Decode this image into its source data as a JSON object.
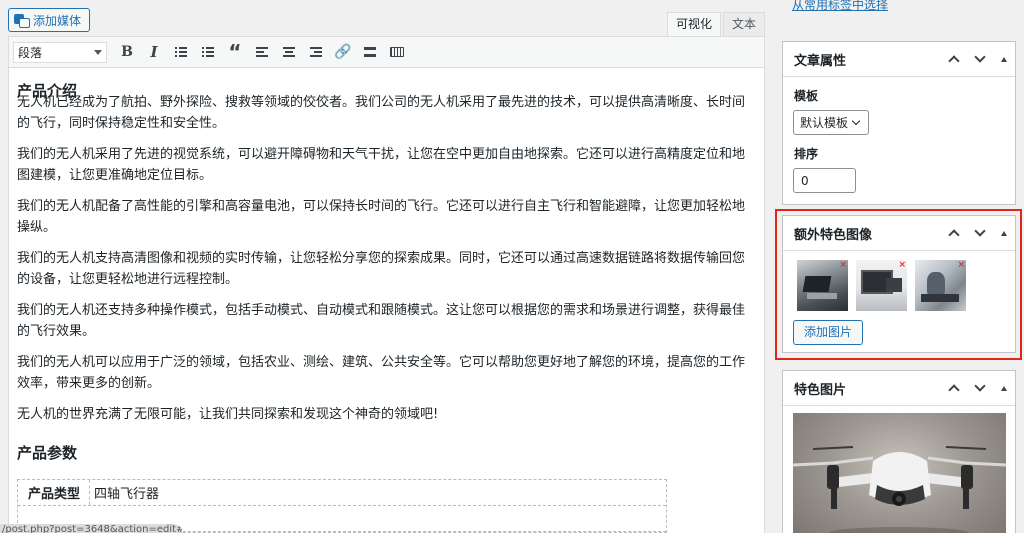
{
  "editor": {
    "add_media_label": "添加媒体",
    "tabs": [
      {
        "label": "可视化",
        "active": true
      },
      {
        "label": "文本",
        "active": false
      }
    ],
    "format_select": "段落",
    "toolbar_icons": [
      "bold-icon",
      "italic-icon",
      "bullet-list-icon",
      "numbered-list-icon",
      "blockquote-icon",
      "align-left-icon",
      "align-center-icon",
      "align-right-icon",
      "link-icon",
      "horizontal-rule-icon",
      "keyboard-shortcut-icon"
    ],
    "cut_heading": "产品介绍",
    "paragraphs": [
      "无人机已经成为了航拍、野外探险、搜救等领域的佼佼者。我们公司的无人机采用了最先进的技术，可以提供高清晰度、长时间的飞行，同时保持稳定性和安全性。",
      "我们的无人机采用了先进的视觉系统，可以避开障碍物和天气干扰，让您在空中更加自由地探索。它还可以进行高精度定位和地图建模，让您更准确地定位目标。",
      "我们的无人机配备了高性能的引擎和高容量电池，可以保持长时间的飞行。它还可以进行自主飞行和智能避障，让您更加轻松地操纵。",
      "我们的无人机支持高清图像和视频的实时传输，让您轻松分享您的探索成果。同时，它还可以通过高速数据链路将数据传输回您的设备，让您更轻松地进行远程控制。",
      "我们的无人机还支持多种操作模式，包括手动模式、自动模式和跟随模式。这让您可以根据您的需求和场景进行调整，获得最佳的飞行效果。",
      "我们的无人机可以应用于广泛的领域，包括农业、测绘、建筑、公共安全等。它可以帮助您更好地了解您的环境，提高您的工作效率，带来更多的创新。",
      "无人机的世界充满了无限可能，让我们共同探索和发现这个神奇的领域吧!"
    ],
    "section_heading": "产品参数",
    "spec_rows": [
      {
        "key": "产品类型",
        "value": "四轴飞行器"
      }
    ],
    "status_path": "/post.php?post=3648&action=edit#"
  },
  "sidebar": {
    "tag_link": "从常用标签中选择",
    "attributes": {
      "title": "文章属性",
      "template_label": "模板",
      "template_value": "默认模板",
      "order_label": "排序",
      "order_value": "0"
    },
    "extra_images": {
      "title": "额外特色图像",
      "remove_mark": "×",
      "add_button": "添加图片",
      "highlight_color": "#e0251b"
    },
    "featured": {
      "title": "特色图片"
    }
  }
}
